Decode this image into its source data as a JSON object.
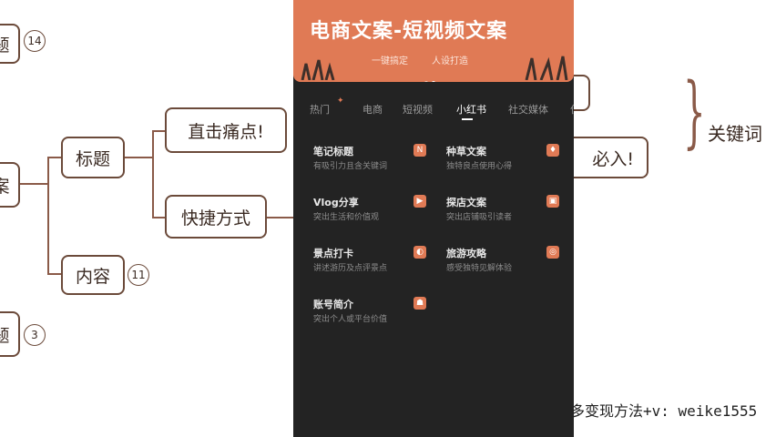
{
  "mindmap": {
    "left_node_top_text": "题",
    "left_node_top_count": "14",
    "left_node_mid_text": "案",
    "left_node_bottom_text": "题",
    "left_node_bottom_count": "3",
    "title_node": "标题",
    "content_node": "内容",
    "content_count": "11",
    "pain_node": "直击痛点!",
    "shortcut_node": "快捷方式",
    "right_must_enter": "必入!",
    "keyword_label": "关键词"
  },
  "phone": {
    "banner": {
      "title": "电商文案-短视频文案",
      "sub_left": "一键搞定",
      "sub_right": "人设打造"
    },
    "tabs": [
      "热门",
      "电商",
      "短视频",
      "小红书",
      "社交媒体",
      "位"
    ],
    "active_tab": "小红书",
    "cards": [
      {
        "title": "笔记标题",
        "desc": "有吸引力且含关键词",
        "icon": "N"
      },
      {
        "title": "种草文案",
        "desc": "独特良点使用心得",
        "icon": "♦"
      },
      {
        "title": "Vlog分享",
        "desc": "突出生活和价值观",
        "icon": "▶"
      },
      {
        "title": "探店文案",
        "desc": "突出店铺吸引读者",
        "icon": "▣"
      },
      {
        "title": "景点打卡",
        "desc": "讲述游历及点评景点",
        "icon": "◐"
      },
      {
        "title": "旅游攻略",
        "desc": "感受独特见解体验",
        "icon": "◎"
      },
      {
        "title": "账号简介",
        "desc": "突出个人或平台价值",
        "icon": "☗"
      }
    ]
  },
  "footer": "多变现方法+v: weike1555"
}
